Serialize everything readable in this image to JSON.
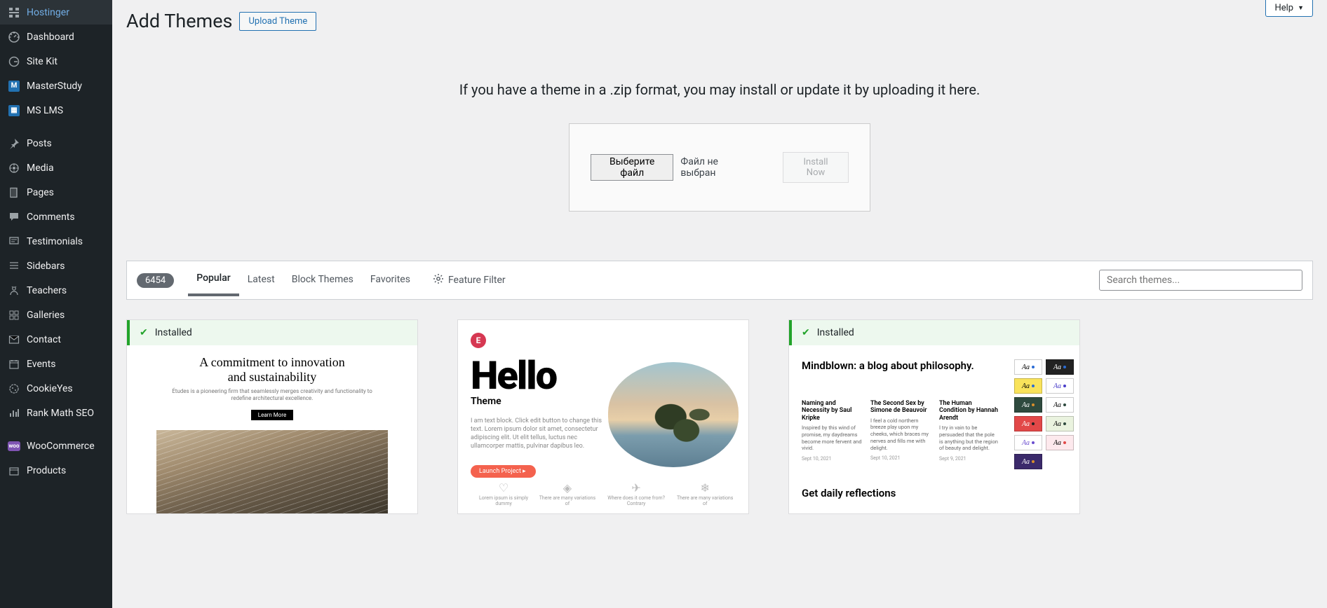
{
  "sidebar": {
    "items": [
      {
        "label": "Hostinger"
      },
      {
        "label": "Dashboard"
      },
      {
        "label": "Site Kit"
      },
      {
        "label": "MasterStudy"
      },
      {
        "label": "MS LMS"
      },
      {
        "label": "Posts"
      },
      {
        "label": "Media"
      },
      {
        "label": "Pages"
      },
      {
        "label": "Comments"
      },
      {
        "label": "Testimonials"
      },
      {
        "label": "Sidebars"
      },
      {
        "label": "Teachers"
      },
      {
        "label": "Galleries"
      },
      {
        "label": "Contact"
      },
      {
        "label": "Events"
      },
      {
        "label": "CookieYes"
      },
      {
        "label": "Rank Math SEO"
      },
      {
        "label": "WooCommerce"
      },
      {
        "label": "Products"
      }
    ]
  },
  "header": {
    "help_label": "Help",
    "title": "Add Themes",
    "upload_button": "Upload Theme"
  },
  "upload": {
    "description": "If you have a theme in a .zip format, you may install or update it by uploading it here.",
    "choose_file": "Выберите файл",
    "no_file": "Файл не выбран",
    "install_now": "Install Now"
  },
  "filter": {
    "count": "6454",
    "tabs": {
      "popular": "Popular",
      "latest": "Latest",
      "block": "Block Themes",
      "favorites": "Favorites"
    },
    "feature_filter": "Feature Filter",
    "search_placeholder": "Search themes..."
  },
  "themes": {
    "installed_label": "Installed",
    "astra": {
      "heading1": "A commitment to innovation",
      "heading2": "and sustainability",
      "sub": "Études is a pioneering firm that seamlessly merges creativity and functionality to redefine architectural excellence.",
      "learn": "Learn More"
    },
    "hello": {
      "big": "Hello",
      "sub": "Theme",
      "body": "I am text block. Click edit button to change this text. Lorem ipsum dolor sit amet, consectetur adipiscing elit. Ut elit tellus, luctus nec ullamcorper mattis, pulvinar dapibus leo.",
      "launch": "Launch Project ▸",
      "icon1_title": "Lorem ipsum is simply dummy",
      "icon2_title": "There are many variations of",
      "icon3_title": "Where does it come from? Contrary",
      "icon4_title": "There are many variations of"
    },
    "tt": {
      "mindblown": "Mindblown: a blog about philosophy.",
      "col1_title": "Naming and Necessity by Saul Kripke",
      "col1_body": "Inspired by this wind of promise, my daydreams become more fervent and vivid.",
      "col2_title": "The Second Sex by Simone de Beauvoir",
      "col2_body": "I feel a cold northern breeze play upon my cheeks, which braces my nerves and fills me with delight.",
      "col3_title": "The Human Condition by Hannah Arendt",
      "col3_body": "I try in vain to be persuaded that the pole is anything but the region of beauty and delight.",
      "date1": "Sept 10, 2021",
      "date2": "Sept 10, 2021",
      "date3": "Sept 9, 2021",
      "daily": "Get daily reflections"
    }
  }
}
